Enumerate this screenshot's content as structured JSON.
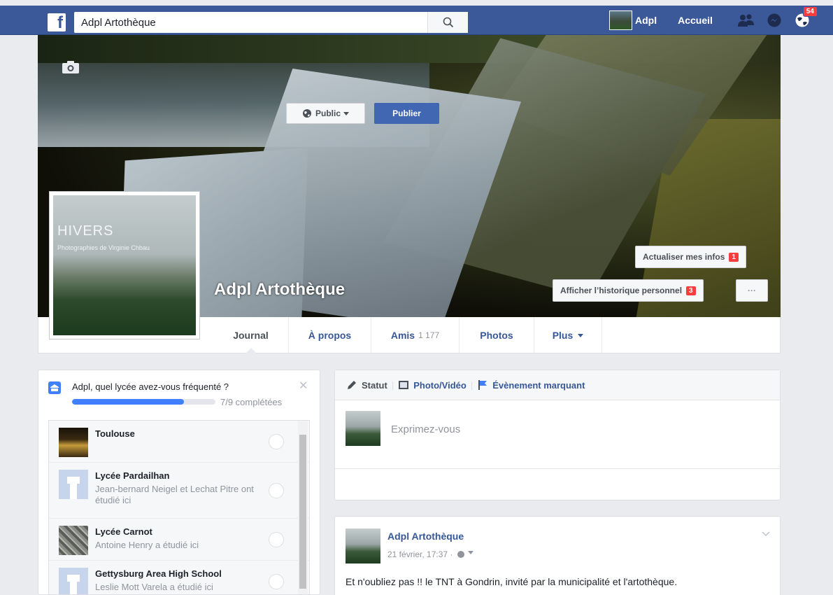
{
  "topbar": {
    "search_value": "Adpl Artothèque",
    "user_name": "Adpl",
    "home_label": "Accueil",
    "notifications_count": "54"
  },
  "cover": {
    "profile_name": "Adpl Artothèque",
    "update_info_label": "Actualiser mes infos",
    "update_info_badge": "1",
    "history_label": "Afficher l’historique personnel",
    "history_badge": "3",
    "more_label": "···"
  },
  "profile_pic": {
    "title": "HIVERS",
    "subtitle": "Photographies de Virginie Chbau"
  },
  "tabs": {
    "journal": "Journal",
    "about": "À propos",
    "friends": "Amis",
    "friends_count": "1 177",
    "photos": "Photos",
    "more": "Plus"
  },
  "school_card": {
    "question": "Adpl, quel lycée avez-vous fréquenté ?",
    "progress_text": "7/9 complétées",
    "progress_fraction": 0.78,
    "items": [
      {
        "title": "Toulouse",
        "subtitle": ""
      },
      {
        "title": "Lycée Pardailhan",
        "subtitle": "Jean-bernard Neigel et Lechat Pitre ont étudié ici"
      },
      {
        "title": "Lycée Carnot",
        "subtitle": "Antoine Henry a étudié ici"
      },
      {
        "title": "Gettysburg Area High School",
        "subtitle": "Leslie Mott Varela a étudié ici"
      }
    ]
  },
  "composer": {
    "status_label": "Statut",
    "photo_video_label": "Photo/Vidéo",
    "life_event_label": "Évènement marquant",
    "placeholder": "Exprimez-vous",
    "audience_label": "Public",
    "publish_label": "Publier"
  },
  "post": {
    "author": "Adpl Artothèque",
    "timestamp": "21 février, 17:37 ·",
    "text": "Et n'oubliez pas !! le TNT à Gondrin, invité par la municipalité et l'artothèque."
  },
  "colors": {
    "brand_blue": "#3b5998",
    "link_blue": "#365899",
    "button_blue": "#4267b2",
    "badge_red": "#fa3e3e",
    "progress_blue": "#4080ff"
  }
}
